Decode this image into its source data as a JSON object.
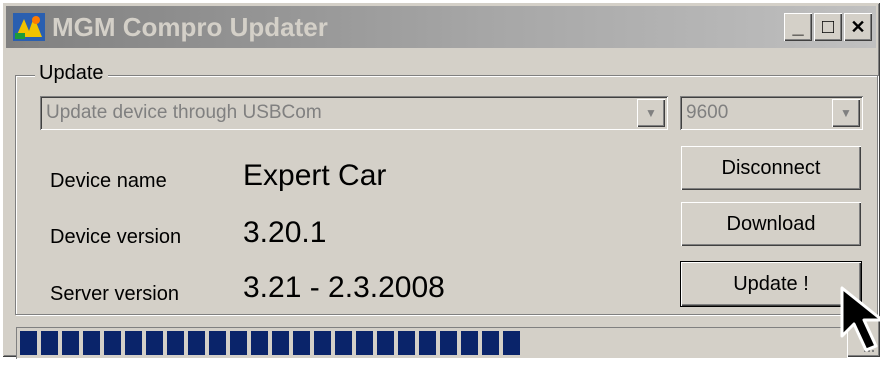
{
  "window": {
    "title": "MGM Compro Updater",
    "controls": {
      "minimize": "_",
      "maximize": "□",
      "close": "✕"
    }
  },
  "group": {
    "label": "Update"
  },
  "connection": {
    "method": "Update device through USBCom",
    "baud": "9600"
  },
  "device": {
    "name_label": "Device name",
    "name_value": "Expert Car",
    "version_label": "Device version",
    "version_value": "3.20.1",
    "server_label": "Server version",
    "server_value": "3.21 - 2.3.2008"
  },
  "buttons": {
    "disconnect": "Disconnect",
    "download": "Download",
    "update": "Update !"
  },
  "progress": {
    "fraction": 0.62,
    "blocks": 24
  },
  "colors": {
    "progress_block": "#0a246a",
    "titlebar_inactive": "#808080",
    "face": "#d4d0c8"
  }
}
